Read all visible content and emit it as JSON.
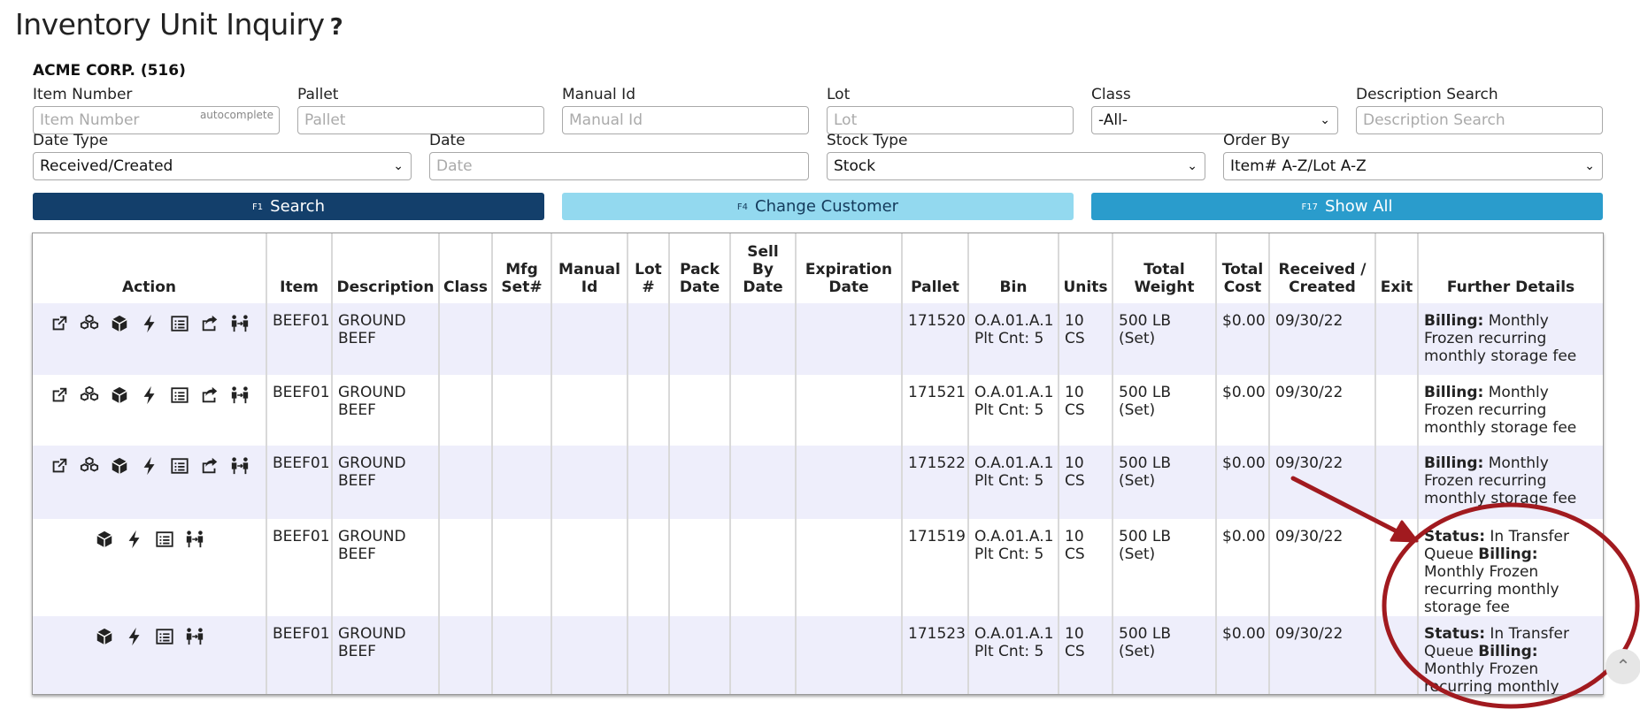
{
  "page": {
    "title": "Inventory Unit Inquiry",
    "help_icon": "?",
    "customer": "ACME CORP. (516)"
  },
  "filters": {
    "item_number": {
      "label": "Item Number",
      "placeholder": "Item Number",
      "hint": "autocomplete"
    },
    "pallet": {
      "label": "Pallet",
      "placeholder": "Pallet"
    },
    "manual_id": {
      "label": "Manual Id",
      "placeholder": "Manual Id"
    },
    "lot": {
      "label": "Lot",
      "placeholder": "Lot"
    },
    "class": {
      "label": "Class",
      "value": "-All-"
    },
    "description_search": {
      "label": "Description Search",
      "placeholder": "Description Search"
    },
    "date_type": {
      "label": "Date Type",
      "value": "Received/Created"
    },
    "date": {
      "label": "Date",
      "placeholder": "Date"
    },
    "stock_type": {
      "label": "Stock Type",
      "value": "Stock"
    },
    "order_by": {
      "label": "Order By",
      "value": "Item# A-Z/Lot A-Z"
    }
  },
  "buttons": {
    "search": {
      "fkey": "F1",
      "label": "Search"
    },
    "change_customer": {
      "fkey": "F4",
      "label": "Change Customer"
    },
    "show_all": {
      "fkey": "F17",
      "label": "Show All"
    }
  },
  "table": {
    "headers": {
      "action": "Action",
      "item": "Item",
      "description": "Description",
      "class": "Class",
      "mfg_1": "Mfg",
      "mfg_2": "Set#",
      "manual_1": "Manual",
      "manual_2": "Id",
      "lot_1": "Lot",
      "lot_2": "#",
      "pack_1": "Pack",
      "pack_2": "Date",
      "sell_1": "Sell",
      "sell_2": "By",
      "sell_3": "Date",
      "exp_1": "Expiration",
      "exp_2": "Date",
      "pallet": "Pallet",
      "bin": "Bin",
      "units": "Units",
      "weight_1": "Total",
      "weight_2": "Weight",
      "cost_1": "Total",
      "cost_2": "Cost",
      "received_1": "Received /",
      "received_2": "Created",
      "exit": "Exit",
      "details": "Further Details"
    },
    "rows": [
      {
        "item": "BEEF01",
        "desc_1": "GROUND",
        "desc_2": "BEEF",
        "pallet": "171520",
        "bin": "O.A.01.A.1",
        "plt_cnt": "Plt Cnt: 5",
        "units": "10 CS",
        "weight": "500 LB (Set)",
        "cost": "$0.00",
        "received": "09/30/22",
        "billing_label": "Billing:",
        "billing_text": "Monthly Frozen recurring monthly storage fee"
      },
      {
        "item": "BEEF01",
        "desc_1": "GROUND",
        "desc_2": "BEEF",
        "pallet": "171521",
        "bin": "O.A.01.A.1",
        "plt_cnt": "Plt Cnt: 5",
        "units": "10 CS",
        "weight": "500 LB (Set)",
        "cost": "$0.00",
        "received": "09/30/22",
        "billing_label": "Billing:",
        "billing_text": "Monthly Frozen recurring monthly storage fee"
      },
      {
        "item": "BEEF01",
        "desc_1": "GROUND",
        "desc_2": "BEEF",
        "pallet": "171522",
        "bin": "O.A.01.A.1",
        "plt_cnt": "Plt Cnt: 5",
        "units": "10 CS",
        "weight": "500 LB (Set)",
        "cost": "$0.00",
        "received": "09/30/22",
        "billing_label": "Billing:",
        "billing_text": "Monthly Frozen recurring monthly storage fee"
      },
      {
        "item": "BEEF01",
        "desc_1": "GROUND",
        "desc_2": "BEEF",
        "pallet": "171519",
        "bin": "O.A.01.A.1",
        "plt_cnt": "Plt Cnt: 5",
        "units": "10 CS",
        "weight": "500 LB (Set)",
        "cost": "$0.00",
        "received": "09/30/22",
        "status_label": "Status:",
        "status_text": "In Transfer Queue",
        "billing_label": "Billing:",
        "billing_text": "Monthly Frozen recurring monthly storage fee"
      },
      {
        "item": "BEEF01",
        "desc_1": "GROUND",
        "desc_2": "BEEF",
        "pallet": "171523",
        "bin": "O.A.01.A.1",
        "plt_cnt": "Plt Cnt: 5",
        "units": "10 CS",
        "weight": "500 LB (Set)",
        "cost": "$0.00",
        "received": "09/30/22",
        "status_label": "Status:",
        "status_text": "In Transfer Queue",
        "billing_label": "Billing:",
        "billing_text": "Monthly Frozen recurring monthly storage fee"
      }
    ]
  },
  "annotation": {
    "color": "#a11a1f"
  },
  "icons": [
    "external-link-icon",
    "boxes-icon",
    "box-icon",
    "bolt-icon",
    "list-icon",
    "share-icon",
    "transfer-people-icon",
    "chevron-up-icon"
  ]
}
